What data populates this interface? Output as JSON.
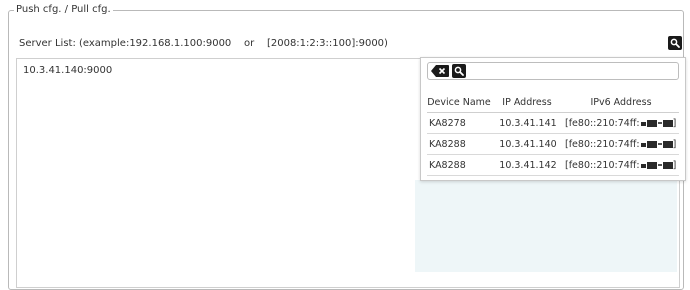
{
  "group": {
    "title": "Push cfg. / Pull cfg."
  },
  "server_list": {
    "label": "Server List: (example:192.168.1.100:9000    or    [2008:1:2:3::100]:9000)",
    "value": "10.3.41.140:9000",
    "search_icon": "search-icon"
  },
  "popup": {
    "clear_icon": "backspace-icon",
    "search_icon": "search-icon",
    "search_value": "",
    "columns": [
      "Device Name",
      "IP Address",
      "IPv6 Address"
    ],
    "rows": [
      {
        "name": "KA8278",
        "ip": "10.3.41.141",
        "ipv6": "[fe80::210:74ff:"
      },
      {
        "name": "KA8288",
        "ip": "10.3.41.140",
        "ipv6": "[fe80::210:74ff:"
      },
      {
        "name": "KA8288",
        "ip": "10.3.41.142",
        "ipv6": "[fe80::210:74ff:"
      }
    ]
  }
}
